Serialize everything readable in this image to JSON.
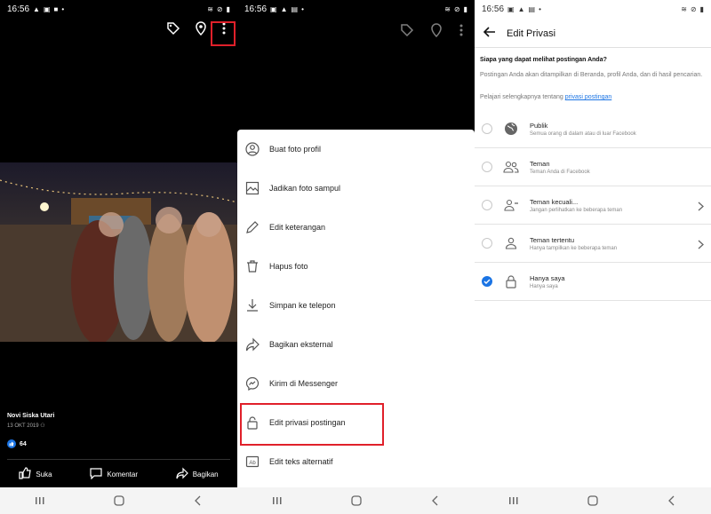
{
  "status_bar": {
    "time": "16:56"
  },
  "viewer": {
    "owner_name": "Novi Siska Utari",
    "date": "13 OKT 2019",
    "like_count": "64",
    "actions": {
      "like": "Suka",
      "comment": "Komentar",
      "share": "Bagikan"
    },
    "top_icons": [
      "tag-icon",
      "location-pin-icon",
      "more-vertical-icon"
    ]
  },
  "photo_menu": {
    "items": [
      {
        "icon": "profile-circle-icon",
        "label": "Buat foto profil"
      },
      {
        "icon": "cover-photo-icon",
        "label": "Jadikan foto sampul"
      },
      {
        "icon": "pencil-icon",
        "label": "Edit keterangan"
      },
      {
        "icon": "trash-icon",
        "label": "Hapus foto"
      },
      {
        "icon": "download-icon",
        "label": "Simpan ke telepon"
      },
      {
        "icon": "share-arrow-icon",
        "label": "Bagikan eksternal"
      },
      {
        "icon": "messenger-icon",
        "label": "Kirim di Messenger"
      },
      {
        "icon": "lock-icon",
        "label": "Edit privasi postingan"
      },
      {
        "icon": "alt-text-icon",
        "label": "Edit teks alternatif"
      }
    ]
  },
  "privacy": {
    "title": "Edit Privasi",
    "question": "Siapa yang dapat melihat postingan Anda?",
    "description": "Postingan Anda akan ditampilkan di Beranda, profil Anda, dan di hasil pencarian.",
    "learn_prefix": "Pelajari selengkapnya tentang ",
    "learn_link": "privasi postingan",
    "options": [
      {
        "label": "Publik",
        "sub": "Semua orang di dalam atau di luar Facebook",
        "icon": "globe-icon",
        "selected": false,
        "has_chevron": false
      },
      {
        "label": "Teman",
        "sub": "Teman Anda di Facebook",
        "icon": "friends-icon",
        "selected": false,
        "has_chevron": false
      },
      {
        "label": "Teman kecuali...",
        "sub": "Jangan perlihatkan ke beberapa teman",
        "icon": "friends-except-icon",
        "selected": false,
        "has_chevron": true
      },
      {
        "label": "Teman tertentu",
        "sub": "Hanya tampilkan ke beberapa teman",
        "icon": "specific-friend-icon",
        "selected": false,
        "has_chevron": true
      },
      {
        "label": "Hanya saya",
        "sub": "Hanya saya",
        "icon": "lock-icon",
        "selected": true,
        "has_chevron": false
      }
    ]
  },
  "colors": {
    "facebook_blue": "#1b74e4",
    "highlight_red": "#e0202a"
  }
}
